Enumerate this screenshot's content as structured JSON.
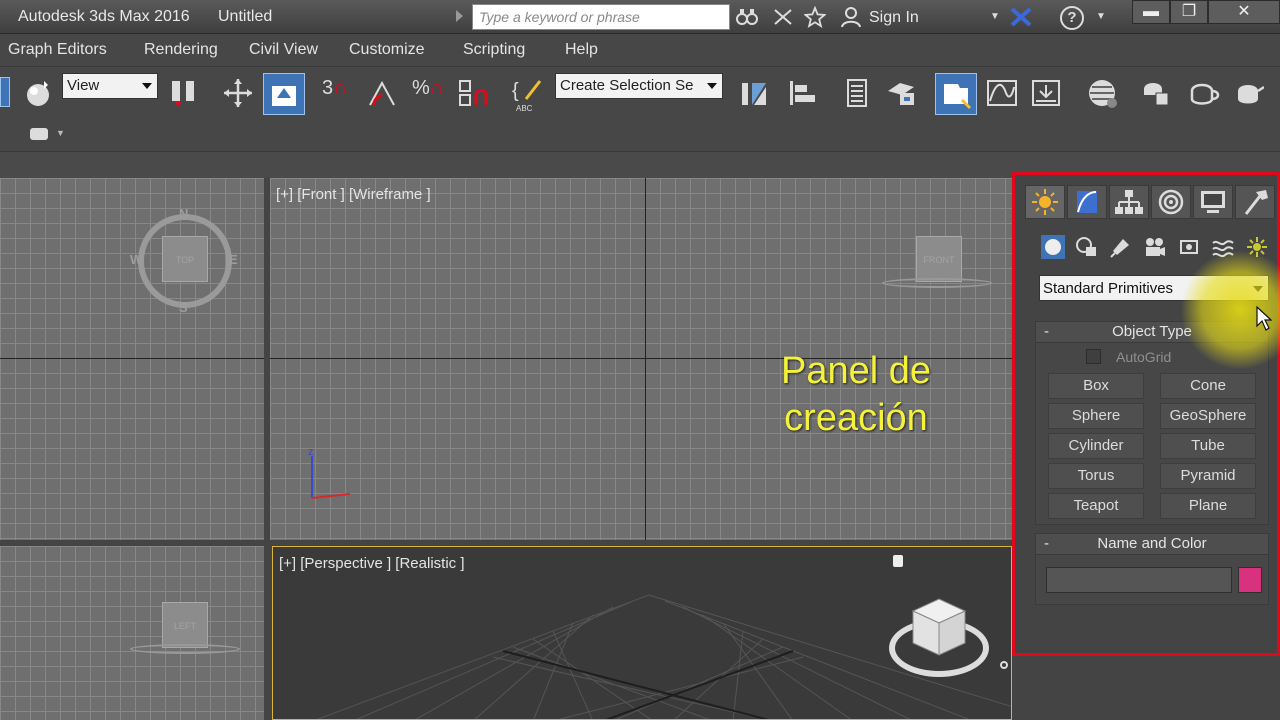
{
  "titlebar": {
    "app": "Autodesk 3ds Max 2016",
    "document": "Untitled",
    "search_placeholder": "Type a keyword or phrase",
    "sign_in": "Sign In",
    "help": "?",
    "minimize": "▬",
    "restore": "❐",
    "close": "✕"
  },
  "menu": {
    "items": [
      "Graph Editors",
      "Rendering",
      "Civil View",
      "Customize",
      "Scripting",
      "Help"
    ]
  },
  "toolbar": {
    "view_select": "View",
    "selection_set": "Create Selection Se",
    "snap_3": "3",
    "snap_percent": "%",
    "abc": "ABC"
  },
  "viewports": {
    "front_label": "[+] [Front ] [Wireframe ]",
    "perspective_label": "[+] [Perspective ] [Realistic ]",
    "top_cube": "TOP",
    "front_cube": "FRONT",
    "left_cube": "LEFT",
    "compass_n": "N",
    "compass_s": "S",
    "compass_e": "E",
    "compass_w": "W",
    "axis_z": "z"
  },
  "overlay": {
    "line1": "Panel de",
    "line2": "creación"
  },
  "command_panel": {
    "tabs": [
      "create-tab",
      "modify-tab",
      "hierarchy-tab",
      "motion-tab",
      "display-tab",
      "utilities-tab"
    ],
    "category_icons": [
      "geometry-icon",
      "shapes-icon",
      "lights-icon",
      "cameras-icon",
      "helpers-icon",
      "space-warps-icon",
      "systems-icon"
    ],
    "dropdown": "Standard Primitives",
    "object_type": {
      "header": "Object Type",
      "collapse": "-",
      "autogrid": "AutoGrid",
      "buttons": [
        "Box",
        "Cone",
        "Sphere",
        "GeoSphere",
        "Cylinder",
        "Tube",
        "Torus",
        "Pyramid",
        "Teapot",
        "Plane"
      ]
    },
    "name_color": {
      "header": "Name and Color",
      "collapse": "-",
      "name_value": "",
      "color": "#d8317e"
    }
  },
  "colors": {
    "panel_highlight": "#e0081b",
    "overlay_text": "#f4f23a",
    "active_tool": "#3e74b5"
  }
}
